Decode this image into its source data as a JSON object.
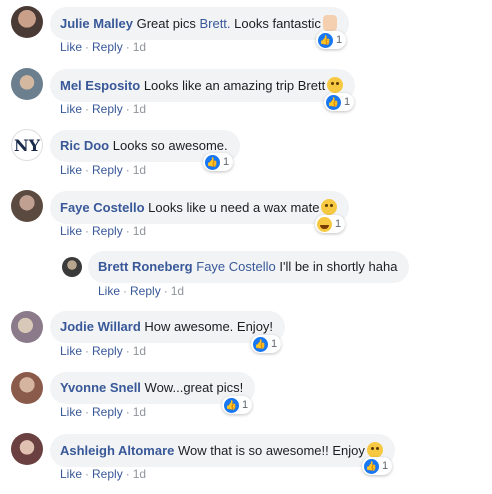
{
  "actions": {
    "like": "Like",
    "reply": "Reply",
    "sep": "·"
  },
  "colors": {
    "link": "#385898",
    "bubble": "#f2f3f5",
    "like_blue": "#1877f2"
  },
  "comments": [
    {
      "author": "Julie Malley",
      "text_pre": "Great pics ",
      "mention": "Brett.",
      "text_post": " Looks fantastic",
      "emoji": "thumbs-up-emoji",
      "time": "1d",
      "reaction": "like",
      "count": "1"
    },
    {
      "author": "Mel Esposito",
      "text_pre": "Looks like an amazing trip Brett",
      "emoji": "grin-emoji",
      "time": "1d",
      "reaction": "like",
      "count": "1"
    },
    {
      "author": "Ric Doo",
      "text_pre": "Looks so awesome.",
      "time": "1d",
      "reaction": "like",
      "count": "1"
    },
    {
      "author": "Faye Costello",
      "text_pre": "Looks like u need a wax mate",
      "emoji": "laughing-emoji",
      "time": "1d",
      "reaction": "haha",
      "count": "1"
    },
    {
      "author": "Brett Roneberg",
      "mention": "Faye Costello",
      "text_post": " I'll be in shortly haha",
      "time": "1d",
      "reply": true
    },
    {
      "author": "Jodie Willard",
      "text_pre": "How awesome. Enjoy!",
      "time": "1d",
      "reaction": "like",
      "count": "1"
    },
    {
      "author": "Yvonne Snell",
      "text_pre": "Wow...great pics!",
      "time": "1d",
      "reaction": "like",
      "count": "1"
    },
    {
      "author": "Ashleigh Altomare",
      "text_pre": "Wow that is so awesome!! Enjoy",
      "emoji": "smile-emoji",
      "time": "1d",
      "reaction": "like",
      "count": "1"
    }
  ]
}
